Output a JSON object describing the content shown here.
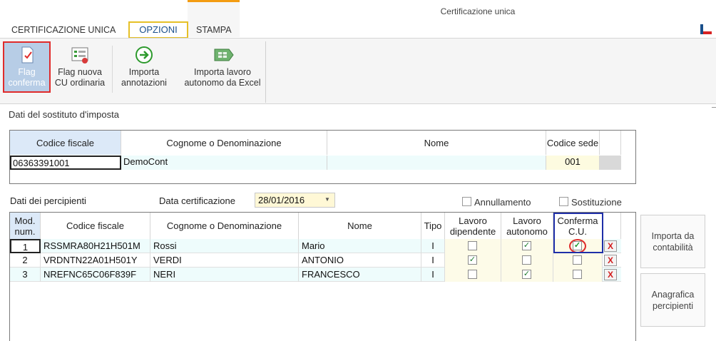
{
  "window": {
    "title": "Certificazione unica"
  },
  "tabs": {
    "cu": "CERTIFICAZIONE UNICA",
    "opzioni": "OPZIONI",
    "stampa": "STAMPA"
  },
  "ribbon": {
    "flag_conferma": "Flag conferma",
    "flag_nuova": "Flag nuova CU ordinaria",
    "importa_annotazioni": "Importa annotazioni",
    "importa_excel": "Importa lavoro autonomo da Excel"
  },
  "sostituto": {
    "section_label": "Dati del sostituto d'imposta",
    "headers": {
      "codice_fiscale": "Codice fiscale",
      "cognome": "Cognome o Denominazione",
      "nome": "Nome",
      "codice_sede": "Codice sede"
    },
    "row": {
      "codice_fiscale": "06363391001",
      "cognome": "DemoCont",
      "nome": "",
      "codice_sede": "001"
    }
  },
  "percipienti": {
    "section_label": "Dati dei percipienti",
    "data_certificazione_label": "Data certificazione",
    "data_certificazione": "28/01/2016",
    "annullamento_label": "Annullamento",
    "sostituzione_label": "Sostituzione",
    "annullamento_checked": false,
    "sostituzione_checked": false,
    "headers": {
      "mod_num": "Mod. num.",
      "codice_fiscale": "Codice fiscale",
      "cognome": "Cognome o Denominazione",
      "nome": "Nome",
      "tipo": "Tipo",
      "lavoro_dipendente": "Lavoro dipendente",
      "lavoro_autonomo": "Lavoro autonomo",
      "conferma_cu": "Conferma C.U."
    },
    "rows": [
      {
        "num": "1",
        "codice_fiscale": "RSSMRA80H21H501M",
        "cognome": "Rossi",
        "nome": "Mario",
        "tipo": "I",
        "dipendente": false,
        "autonomo": true,
        "conferma": true
      },
      {
        "num": "2",
        "codice_fiscale": "VRDNTN22A01H501Y",
        "cognome": "VERDI",
        "nome": "ANTONIO",
        "tipo": "I",
        "dipendente": true,
        "autonomo": false,
        "conferma": false
      },
      {
        "num": "3",
        "codice_fiscale": "NREFNC65C06F839F",
        "cognome": "NERI",
        "nome": "FRANCESCO",
        "tipo": "I",
        "dipendente": false,
        "autonomo": true,
        "conferma": false
      }
    ]
  },
  "side_buttons": {
    "importa_contabilita": "Importa da contabilità",
    "anagrafica": "Anagrafica percipienti"
  },
  "colors": {
    "accent_tab": "#e6c027",
    "stampa_accent": "#f39c12",
    "flag_highlight": "#e02b2b",
    "conferma_highlight": "#1f2fa8"
  }
}
